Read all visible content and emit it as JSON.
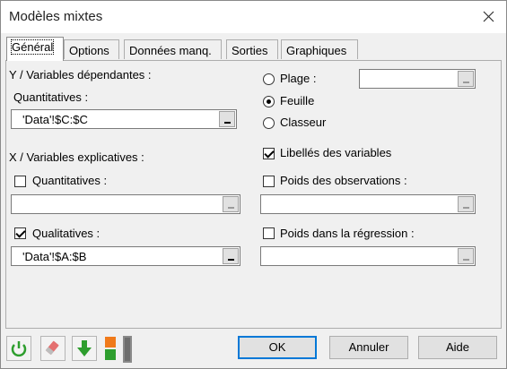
{
  "window": {
    "title": "Modèles mixtes"
  },
  "tabs": [
    {
      "label": "Général",
      "active": true
    },
    {
      "label": "Options"
    },
    {
      "label": "Données manq."
    },
    {
      "label": "Sorties"
    },
    {
      "label": "Graphiques"
    }
  ],
  "general": {
    "y_section": "Y / Variables dépendantes :",
    "y_quant_label": "Quantitatives :",
    "y_quant_value": "'Data'!$C:$C",
    "x_section": "X / Variables explicatives :",
    "x_quant_label": "Quantitatives :",
    "x_quant_checked": false,
    "x_quant_value": "",
    "x_qual_label": "Qualitatives :",
    "x_qual_checked": true,
    "x_qual_value": "'Data'!$A:$B",
    "range_options": [
      {
        "label": "Plage :",
        "selected": false
      },
      {
        "label": "Feuille",
        "selected": true
      },
      {
        "label": "Classeur",
        "selected": false
      }
    ],
    "range_value": "",
    "var_labels": {
      "label": "Libellés des variables",
      "checked": true
    },
    "obs_weights": {
      "label": "Poids des observations :",
      "checked": false,
      "value": ""
    },
    "reg_weights": {
      "label": "Poids dans la régression :",
      "checked": false,
      "value": ""
    }
  },
  "toolbar": {
    "icons": [
      "reset-icon",
      "eraser-icon",
      "down-arrow-icon",
      "layout-toggle-icon"
    ]
  },
  "buttons": {
    "ok": "OK",
    "cancel": "Annuler",
    "help": "Aide"
  },
  "colors": {
    "accent": "#0078d7",
    "green": "#2e9e2e",
    "orange": "#f07a1a"
  }
}
